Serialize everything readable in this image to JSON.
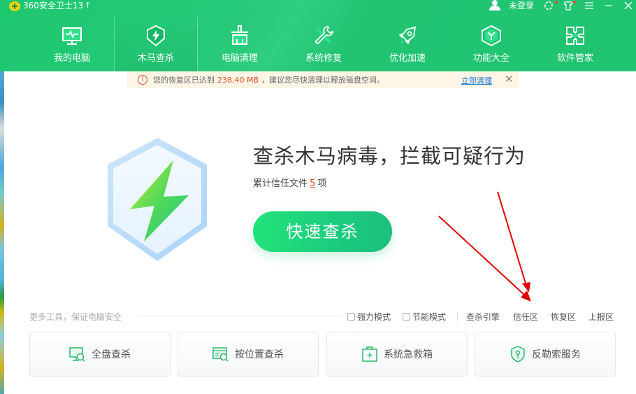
{
  "titlebar": {
    "app_title": "360安全卫士13",
    "upgrade_icon": "↑",
    "login_label": "未登录",
    "icons": [
      "user-icon",
      "plugin-icon",
      "skin-icon",
      "menu-icon",
      "minimize-icon",
      "close-icon"
    ]
  },
  "nav": {
    "items": [
      {
        "label": "我的电脑",
        "icon": "monitor-icon"
      },
      {
        "label": "木马查杀",
        "icon": "shield-bolt-icon",
        "active": true
      },
      {
        "label": "电脑清理",
        "icon": "broom-icon"
      },
      {
        "label": "系统修复",
        "icon": "wrench-icon"
      },
      {
        "label": "优化加速",
        "icon": "rocket-icon"
      },
      {
        "label": "功能大全",
        "icon": "cube-icon"
      },
      {
        "label": "软件管家",
        "icon": "app-grid-icon"
      }
    ]
  },
  "notice": {
    "icon": "!",
    "text_before": "您的恢复区已达到",
    "size": "238.40 MB",
    "text_after": "，建议您尽快清理以释放磁盘空间。",
    "link": "立即清理",
    "close": "✕"
  },
  "hero": {
    "title": "查杀木马病毒，拦截可疑行为",
    "sub_before": "累计信任文件",
    "count": "5",
    "sub_after": "项",
    "scan_button": "快速查杀"
  },
  "tools": {
    "label": "更多工具，保证电脑安全",
    "options": [
      {
        "label": "强力模式",
        "checked": false
      },
      {
        "label": "节能模式",
        "checked": false
      }
    ],
    "links": [
      "查杀引擎",
      "信任区",
      "恢复区",
      "上报区"
    ],
    "cards": [
      {
        "label": "全盘查杀",
        "icon": "monitor-search-icon"
      },
      {
        "label": "按位置查杀",
        "icon": "folder-search-icon"
      },
      {
        "label": "系统急救箱",
        "icon": "first-aid-kit-icon"
      },
      {
        "label": "反勒索服务",
        "icon": "shield-lock-icon"
      }
    ]
  },
  "colors": {
    "brand_green": "#1fc470",
    "accent_orange": "#e8502a",
    "link_blue": "#1a78d0",
    "annotation_red": "#e00000"
  }
}
